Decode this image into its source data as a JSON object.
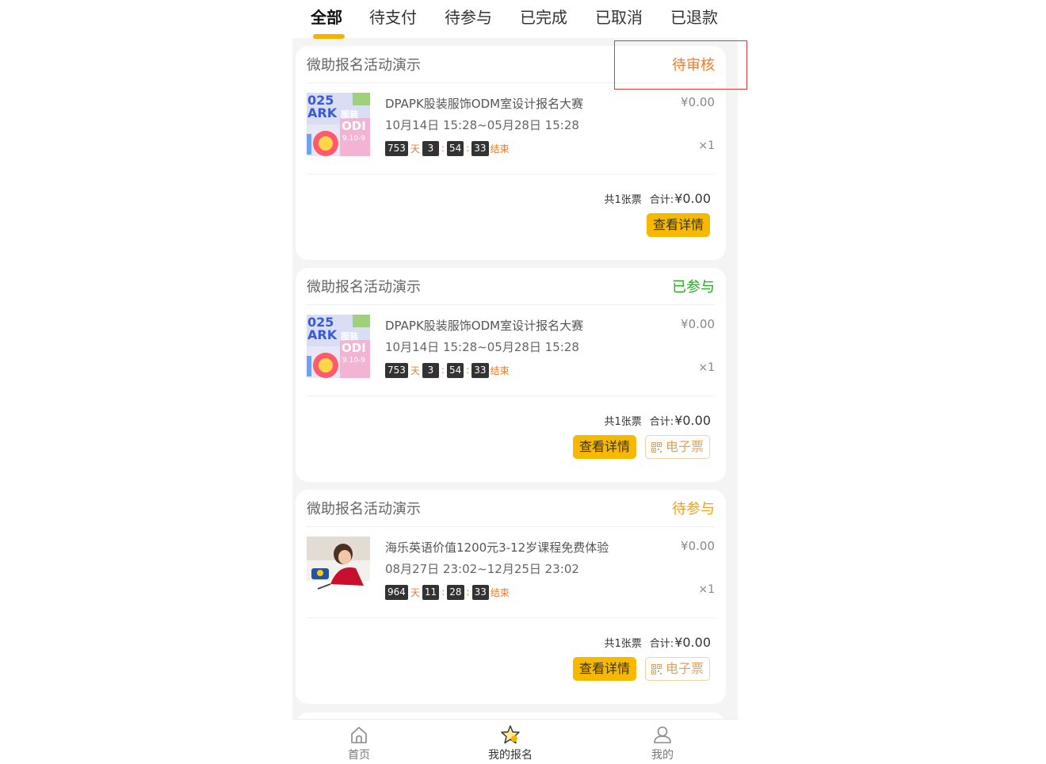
{
  "tabs": [
    "全部",
    "待支付",
    "待参与",
    "已完成",
    "已取消",
    "已退款"
  ],
  "orders": [
    {
      "shop": "微助报名活动演示",
      "status": "待审核",
      "status_color": "#f07a2a",
      "title": "DPAPK股装服饰ODM室设计报名大赛",
      "price": "¥0.00",
      "time": "10月14日 15:28~05月28日 15:28",
      "countdown": {
        "days": "753",
        "day_unit": "天",
        "hours": "3",
        "minutes": "54",
        "seconds": "33",
        "suffix": "结束"
      },
      "qty": "×1",
      "ticket_count": "共1张票",
      "total_label": "合计:",
      "total": "¥0.00",
      "detail_label": "查看详情",
      "thumb": "poster",
      "thumb_text": {
        "line1": "025",
        "line2": "ARK",
        "line3": "服装",
        "line4": "ODI",
        "line5": "9.10-9"
      }
    },
    {
      "shop": "微助报名活动演示",
      "status": "已参与",
      "status_color": "#1fb01f",
      "title": "DPAPK股装服饰ODM室设计报名大赛",
      "price": "¥0.00",
      "time": "10月14日 15:28~05月28日 15:28",
      "countdown": {
        "days": "753",
        "day_unit": "天",
        "hours": "3",
        "minutes": "54",
        "seconds": "33",
        "suffix": "结束"
      },
      "qty": "×1",
      "ticket_count": "共1张票",
      "total_label": "合计:",
      "total": "¥0.00",
      "detail_label": "查看详情",
      "ticket_label": "电子票",
      "thumb": "poster",
      "thumb_text": {
        "line1": "025",
        "line2": "ARK",
        "line3": "服装",
        "line4": "ODI",
        "line5": "9.10-9"
      }
    },
    {
      "shop": "微助报名活动演示",
      "status": "待参与",
      "status_color": "#f0a020",
      "title": "海乐英语价值1200元3-12岁课程免费体验",
      "price": "¥0.00",
      "time": "08月27日 23:02~12月25日 23:02",
      "countdown": {
        "days": "964",
        "day_unit": "天",
        "hours": "11",
        "minutes": "28",
        "seconds": "33",
        "suffix": "结束"
      },
      "qty": "×1",
      "ticket_count": "共1张票",
      "total_label": "合计:",
      "total": "¥0.00",
      "detail_label": "查看详情",
      "ticket_label": "电子票",
      "thumb": "photo"
    }
  ],
  "bottom_nav": [
    {
      "label": "首页",
      "icon": "home-icon"
    },
    {
      "label": "我的报名",
      "icon": "star-icon"
    },
    {
      "label": "我的",
      "icon": "user-icon"
    }
  ],
  "colors": {
    "accent": "#f7b800",
    "page_bg": "#f4f4f4",
    "highlight": "#e0393b"
  }
}
